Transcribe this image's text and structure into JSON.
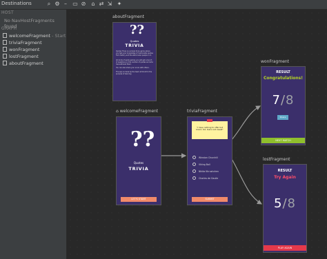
{
  "toolbar": {
    "title": "Destinations"
  },
  "left_panel": {
    "host_section": "HOST",
    "no_host_msg": "No NavHostFragments found",
    "graph_section": "GRAPH",
    "items": [
      {
        "label": "welcomeFragment",
        "suffix": "- Start"
      },
      {
        "label": "triviaFragment",
        "suffix": ""
      },
      {
        "label": "wonFragment",
        "suffix": ""
      },
      {
        "label": "lostFragment",
        "suffix": ""
      },
      {
        "label": "aboutFragment",
        "suffix": ""
      }
    ]
  },
  "about": {
    "label": "aboutFragment",
    "title1": "Quotes",
    "title2": "TRIVIA",
    "body1": "Quotes Trivia is a simple trivia game where you test your knowledge of memorable quotes from history and the well-known people in it.",
    "body2": "All kinds of quote games you will get a bunch of questions on the number of quotes and who has authored them.",
    "body3": "You can also share your score with others.",
    "body4": "The app is made by the team at Droid for the purpose of learning."
  },
  "welcome": {
    "label": "welcomeFragment",
    "title1": "Quotes",
    "title2": "TRIVIA",
    "button": "LET'S START"
  },
  "trivia": {
    "label": "triviaFragment",
    "quote": "\"I have nothing to offer but blood, toil, tears and sweat\"",
    "options": [
      "Winston Churchill",
      "Viking Boll",
      "Nikita Khrushchev",
      "Charles de Gaulle"
    ],
    "button": "SUBMIT"
  },
  "won": {
    "label": "wonFragment",
    "result": "RESULT",
    "headline": "Congratulations!",
    "score": "7",
    "total": "8",
    "share": "Share",
    "button": "NEXT MATCH"
  },
  "lost": {
    "label": "lostFragment",
    "result": "RESULT",
    "headline": "Try Again",
    "score": "5",
    "total": "8",
    "button": "PLAY AGAIN"
  },
  "colors": {
    "phone_bg": "#3b2f6b",
    "won_headline": "#b7d624",
    "lost_headline": "#ff4d6a",
    "start_button": "#f08a6a"
  }
}
